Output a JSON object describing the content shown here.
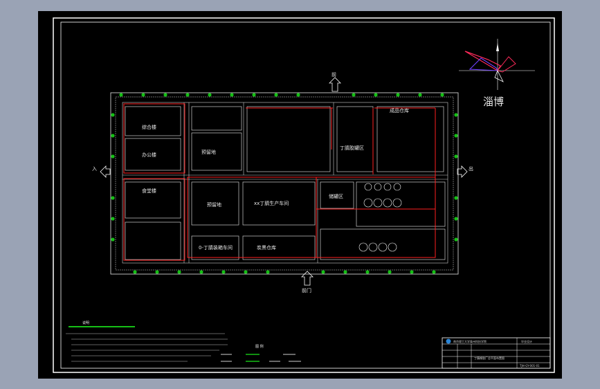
{
  "drawing": {
    "compass_label": "淄博",
    "gate_north": "前",
    "gate_south": "前门",
    "gate_west": "入",
    "gate_east": "出",
    "colors": {
      "background": "#000000",
      "app_frame": "#9aa3b5",
      "border": "#ffffff",
      "road": "#cfcfcf",
      "fire_line": "#ff2020",
      "tree": "#16c016",
      "text": "#e8e8e8"
    },
    "buildings": [
      "综合楼",
      "办公楼",
      "食堂楼",
      "预留地",
      "xx丁腈生产车间",
      "储罐区",
      "丁腈胶罐区",
      "0-丁腈装箱车间",
      "炭黑仓库",
      "预留地",
      "成品仓库"
    ],
    "legend_title": "图 例",
    "notes_title": "说明"
  },
  "title_block": {
    "school": "南京理工大学泰州科技学院",
    "drawing_name": "丁腈橡胶厂总平面布置图",
    "drawing_no": "TJH-GY-001-01",
    "stage": "毕业设计"
  }
}
